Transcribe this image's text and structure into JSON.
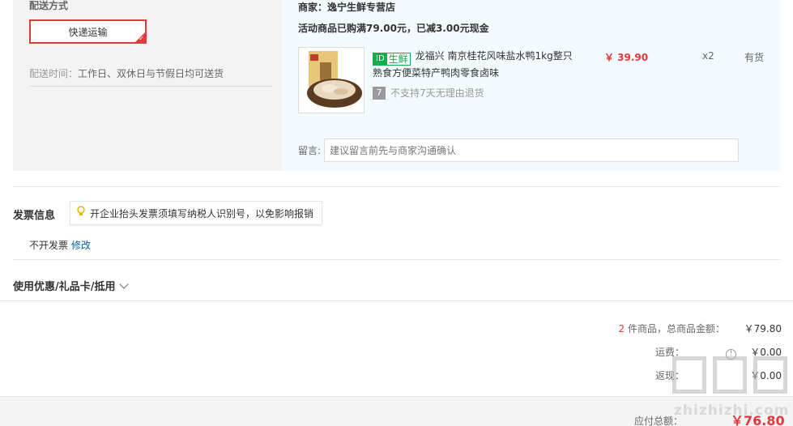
{
  "shipping": {
    "title": "配送方式",
    "method": "快递运输",
    "time_label": "配送时间：",
    "time_value": "工作日、双休日与节假日均可送货"
  },
  "shop": {
    "name": "商家：逸宁生鲜专营店",
    "promo": "活动商品已购满79.00元，已减3.00元现金"
  },
  "product": {
    "tag_icon": "ID",
    "tag_text": "生鲜",
    "title": "龙福兴 南京桂花风味盐水鸭1kg整只 熟食方便菜特产鸭肉零食卤味",
    "return_icon": "7",
    "return_text": "不支持7天无理由退货",
    "price": "￥ 39.90",
    "quantity": "x2",
    "stock": "有货",
    "image_icon": "duck-product-image"
  },
  "message": {
    "label": "留言:",
    "placeholder": "建议留言前先与商家沟通确认"
  },
  "invoice": {
    "title": "发票信息",
    "tip": "开企业抬头发票须填写纳税人识别号，以免影响报销",
    "status": "不开发票",
    "edit": "修改"
  },
  "coupon": {
    "label": "使用优惠/礼品卡/抵用"
  },
  "summary": {
    "count": "2",
    "count_suffix": " 件商品，总商品金额：",
    "goods_total": "￥79.80",
    "shipping_label": "运费：",
    "shipping_value": "￥0.00",
    "rebate_label": "返现：",
    "rebate_value": "￥0.00"
  },
  "payable": {
    "label": "应付总额：",
    "value": "￥76.80"
  },
  "watermark": {
    "text": "zhizhizhi.com"
  },
  "colors": {
    "accent": "#e4393c",
    "fresh_green": "#1bab4a",
    "link_blue": "#005ea7"
  }
}
